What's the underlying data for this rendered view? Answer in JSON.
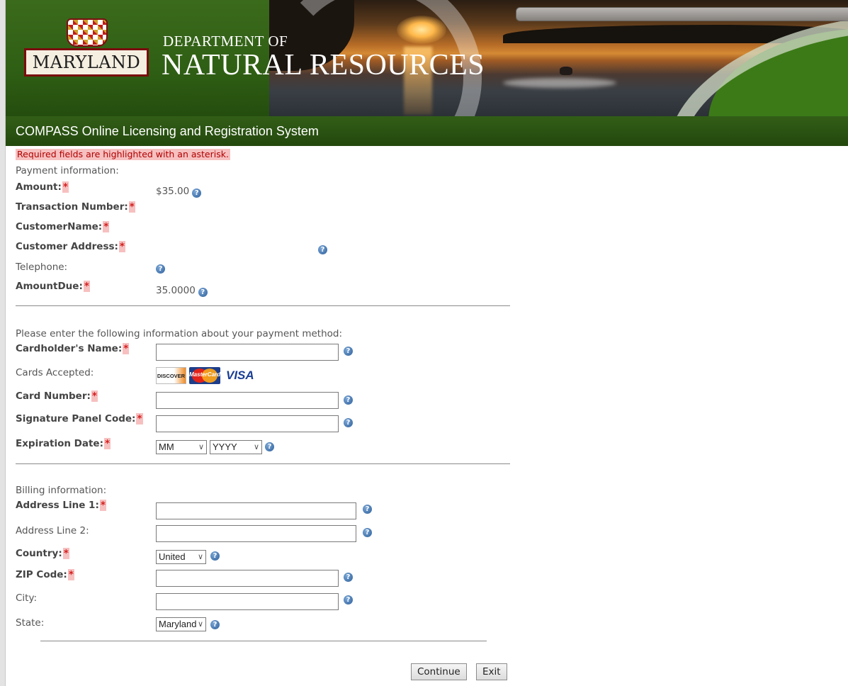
{
  "header": {
    "state_logo_text": "MARYLAND",
    "dept_line1": "DEPARTMENT OF",
    "dept_line2": "NATURAL RESOURCES",
    "system_title": "COMPASS Online Licensing and Registration System"
  },
  "required_note": "Required fields are highlighted with an asterisk.",
  "payment_info": {
    "heading": "Payment information:",
    "amount": {
      "label": "Amount:",
      "value": "$35.00"
    },
    "transaction_number": {
      "label": "Transaction Number:"
    },
    "customer_name": {
      "label": "CustomerName:"
    },
    "customer_address": {
      "label": "Customer Address:"
    },
    "telephone": {
      "label": "Telephone:"
    },
    "amount_due": {
      "label": "AmountDue:",
      "value": "35.0000"
    }
  },
  "payment_method": {
    "heading": "Please enter the following information about your payment method:",
    "cardholder_name": {
      "label": "Cardholder's Name:",
      "value": ""
    },
    "cards_accepted": {
      "label": "Cards Accepted:",
      "cards": [
        "DISCOVER",
        "MasterCard",
        "VISA"
      ]
    },
    "card_number": {
      "label": "Card Number:",
      "value": ""
    },
    "signature_code": {
      "label": "Signature Panel Code:",
      "value": ""
    },
    "expiration": {
      "label": "Expiration Date:",
      "month": "MM",
      "year": "YYYY"
    }
  },
  "billing": {
    "heading": "Billing information:",
    "address1": {
      "label": "Address Line 1:",
      "value": ""
    },
    "address2": {
      "label": "Address Line 2:",
      "value": ""
    },
    "country": {
      "label": "Country:",
      "selected": "United"
    },
    "zip": {
      "label": "ZIP Code:",
      "value": ""
    },
    "city": {
      "label": "City:",
      "value": ""
    },
    "state": {
      "label": "State:",
      "selected": "Maryland"
    }
  },
  "required_marker": "*",
  "help_icon_glyph": "?",
  "dropdown_glyph": "∨",
  "buttons": {
    "continue": "Continue",
    "exit": "Exit"
  },
  "colors": {
    "banner_green": "#2f5f14",
    "required_bg": "#f7c0c0",
    "required_text": "#b00000",
    "help_blue": "#2d5f9a"
  }
}
